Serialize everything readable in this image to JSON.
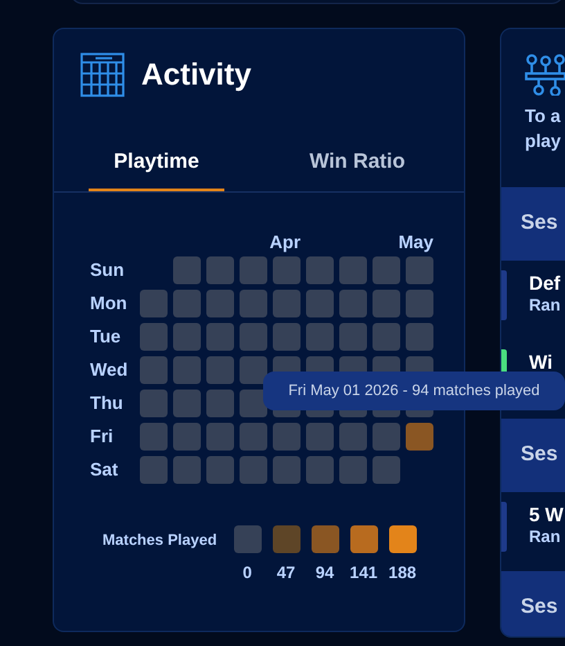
{
  "card": {
    "title": "Activity"
  },
  "tabs": [
    {
      "label": "Playtime",
      "selected": true
    },
    {
      "label": "Win Ratio",
      "selected": false
    }
  ],
  "heatmap": {
    "months": [
      {
        "label": "Apr"
      },
      {
        "label": "May"
      }
    ],
    "rows": [
      {
        "day": "Sun",
        "cells": [
          {
            "color": "#364157"
          },
          {
            "color": "#364157"
          },
          {
            "color": "#364157"
          },
          {
            "color": "#364157"
          },
          {
            "color": "#364157"
          },
          {
            "color": "#364157"
          },
          {
            "color": "#364157"
          },
          {
            "color": "#364157"
          }
        ]
      },
      {
        "day": "Mon",
        "cells": [
          {
            "color": "#364157"
          },
          {
            "color": "#364157"
          },
          {
            "color": "#364157"
          },
          {
            "color": "#364157"
          },
          {
            "color": "#364157"
          },
          {
            "color": "#364157"
          },
          {
            "color": "#364157"
          },
          {
            "color": "#364157"
          },
          {
            "color": "#364157"
          }
        ]
      },
      {
        "day": "Tue",
        "cells": [
          {
            "color": "#364157"
          },
          {
            "color": "#364157"
          },
          {
            "color": "#364157"
          },
          {
            "color": "#364157"
          },
          {
            "color": "#364157"
          },
          {
            "color": "#364157"
          },
          {
            "color": "#364157"
          },
          {
            "color": "#364157"
          },
          {
            "color": "#364157"
          }
        ]
      },
      {
        "day": "Wed",
        "cells": [
          {
            "color": "#364157"
          },
          {
            "color": "#364157"
          },
          {
            "color": "#364157"
          },
          {
            "color": "#364157"
          },
          {
            "color": "#364157"
          },
          {
            "color": "#364157"
          },
          {
            "color": "#364157"
          },
          {
            "color": "#364157"
          },
          {
            "color": "#364157"
          }
        ]
      },
      {
        "day": "Thu",
        "cells": [
          {
            "color": "#364157"
          },
          {
            "color": "#364157"
          },
          {
            "color": "#364157"
          },
          {
            "color": "#364157"
          },
          {
            "color": "#364157"
          },
          {
            "color": "#364157"
          },
          {
            "color": "#364157"
          },
          {
            "color": "#364157"
          },
          {
            "color": "#364157"
          }
        ]
      },
      {
        "day": "Fri",
        "cells": [
          {
            "color": "#364157"
          },
          {
            "color": "#364157"
          },
          {
            "color": "#364157"
          },
          {
            "color": "#364157"
          },
          {
            "color": "#364157"
          },
          {
            "color": "#364157"
          },
          {
            "color": "#364157"
          },
          {
            "color": "#364157"
          },
          {
            "color": "#8a5623"
          }
        ]
      },
      {
        "day": "Sat",
        "cells": [
          {
            "color": "#364157"
          },
          {
            "color": "#364157"
          },
          {
            "color": "#364157"
          },
          {
            "color": "#364157"
          },
          {
            "color": "#364157"
          },
          {
            "color": "#364157"
          },
          {
            "color": "#364157"
          },
          {
            "color": "#364157"
          }
        ]
      }
    ],
    "tooltip": "Fri May 01 2026 - 94 matches played"
  },
  "legend": {
    "label": "Matches Played",
    "steps": [
      {
        "value": "0",
        "color": "#364157"
      },
      {
        "value": "47",
        "color": "#5e4527"
      },
      {
        "value": "94",
        "color": "#8a5623"
      },
      {
        "value": "141",
        "color": "#b86b1f"
      },
      {
        "value": "188",
        "color": "#e3841a"
      }
    ]
  },
  "side_panel": {
    "intro": [
      "To a",
      "play"
    ],
    "items": [
      {
        "kind": "section",
        "title": "Ses"
      },
      {
        "kind": "entry",
        "title": "Def",
        "subtitle": "Ran",
        "color": "#1e3a8a"
      },
      {
        "kind": "entry",
        "title": "Wi",
        "color": "#4ade80"
      },
      {
        "kind": "section",
        "title": "Ses"
      },
      {
        "kind": "entry",
        "title": "5 W",
        "subtitle": "Ran",
        "color": "#1e3a8a"
      },
      {
        "kind": "section",
        "title": "Ses"
      }
    ]
  }
}
